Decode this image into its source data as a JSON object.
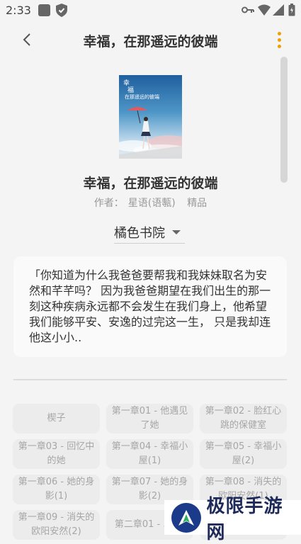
{
  "status": {
    "time": "2:33"
  },
  "header": {
    "title": "幸福，在那遥远的彼端"
  },
  "book": {
    "title": "幸福，在那遥远的彼端",
    "author_label": "作者：",
    "author": "星语(语甎)",
    "tag": "精品",
    "source": "橘色书院",
    "intro": "「你知道为什么我爸爸要帮我和我妹妹取名为安然和芊芊吗？ 因为我爸爸期望在我们出生的那一刻这种疾病永远都不会发生在我们身上，他希望我们能够平安、安逸的过完这一生， 只是我却连他这小小.."
  },
  "chapters": [
    "楔子",
    "第一章01 - 他遇见了她",
    "第一章02 - 脸红心跳的保健室",
    "第一章03 - 回忆中的她",
    "第一章04 - 幸福小屋(1)",
    "第一章05 - 幸福小屋(2)",
    "第一章06 - 她的身影(1)",
    "第一章07 - 她的身影(2)",
    "第一章08 - 消失的欧阳安然(1)",
    "第一章09 - 消失的欧阳安然(2)",
    "第二章01 - ...(1)",
    ""
  ],
  "watermark": {
    "text": "极限手游网"
  },
  "colors": {
    "accent": "#f0a000",
    "background": "#f4f4f4"
  }
}
